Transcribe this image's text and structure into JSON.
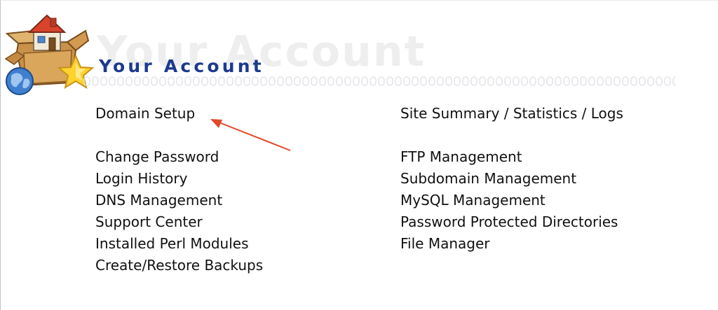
{
  "header": {
    "title": "Your Account",
    "watermark": "Your Account",
    "logo_icon": "house-in-box-with-globe-and-star-icon"
  },
  "menu": {
    "left": [
      {
        "label": "Domain Setup"
      },
      {
        "label": "Change Password"
      },
      {
        "label": "Login History"
      },
      {
        "label": "DNS Management"
      },
      {
        "label": "Support Center"
      },
      {
        "label": "Installed Perl Modules"
      },
      {
        "label": "Create/Restore Backups"
      }
    ],
    "right": [
      {
        "label": "Site Summary / Statistics / Logs"
      },
      {
        "label": "FTP Management"
      },
      {
        "label": "Subdomain Management"
      },
      {
        "label": "MySQL Management"
      },
      {
        "label": "Password Protected Directories"
      },
      {
        "label": "File Manager"
      }
    ]
  },
  "annotation": {
    "arrow_color": "#e04a2a",
    "points_to": "Domain Setup"
  },
  "colors": {
    "title": "#1c3a8e",
    "watermark": "#eeeeee",
    "link_text": "#111111"
  }
}
